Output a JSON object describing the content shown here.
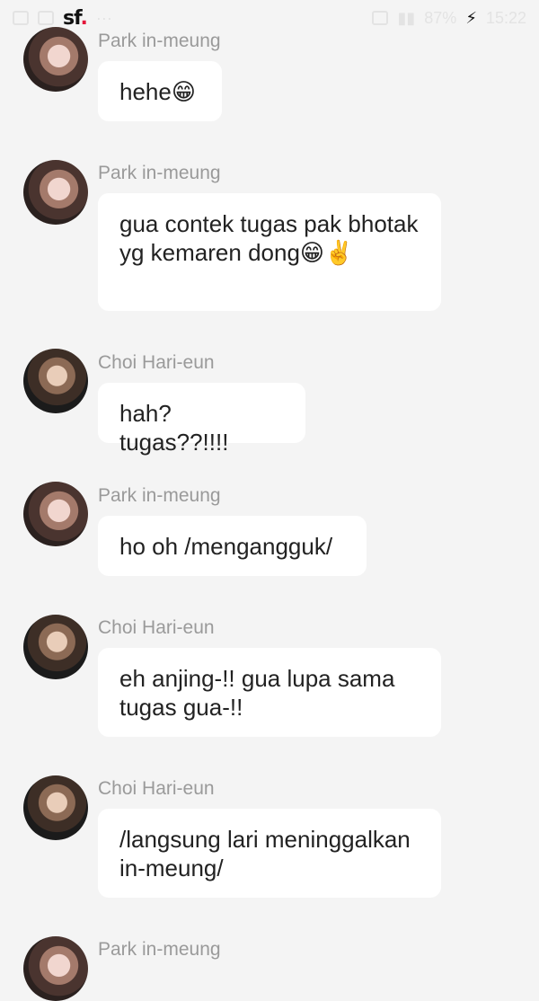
{
  "status_bar": {
    "logo_text": "sf",
    "battery_text": "87%",
    "time_text": "15:22"
  },
  "messages": [
    {
      "sender": "Park in-meung",
      "text": "hehe😁",
      "avatar": "park-avatar"
    },
    {
      "sender": "Park in-meung",
      "text": "gua contek tugas pak bhotak yg kemaren dong😁✌️",
      "avatar": "park-avatar"
    },
    {
      "sender": "Choi Hari-eun",
      "text": "hah? tugas??!!!!",
      "avatar": "choi-avatar"
    },
    {
      "sender": "Park in-meung",
      "text": "ho oh /mengangguk/",
      "avatar": "park-avatar"
    },
    {
      "sender": "Choi Hari-eun",
      "text": "eh anjing-!! gua lupa sama tugas gua-!!",
      "avatar": "choi-avatar"
    },
    {
      "sender": "Choi Hari-eun",
      "text": "/langsung lari meninggalkan in-meung/",
      "avatar": "choi-avatar"
    },
    {
      "sender": "Park in-meung",
      "text": "",
      "avatar": "park-avatar"
    }
  ]
}
